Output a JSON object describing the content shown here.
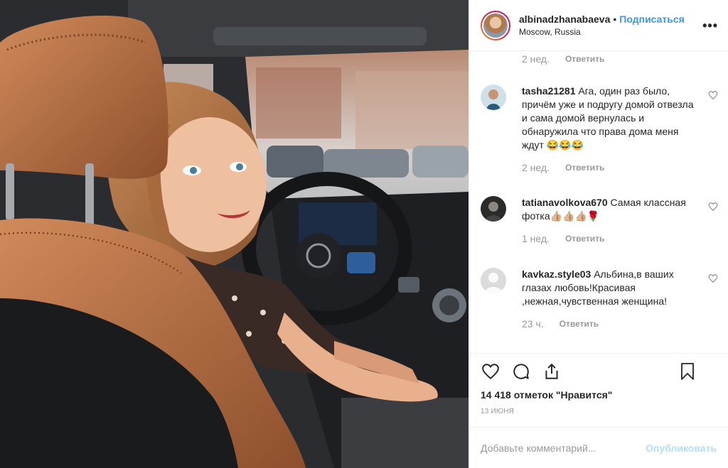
{
  "header": {
    "username": "albinadzhanabaeva",
    "separator": "•",
    "follow_label": "Подписаться",
    "location": "Moscow, Russia",
    "more_label": "•••"
  },
  "top_meta": {
    "time": "2 нед.",
    "reply_label": "Ответить"
  },
  "comments": [
    {
      "user": "tasha21281",
      "text": "Ага, один раз было, причём уже и подругу домой отвезла и сама домой вернулась и обнаружила что права дома меня ждут 😂😂😂",
      "time": "2 нед.",
      "reply_label": "Ответить"
    },
    {
      "user": "tatianavolkova670",
      "text": "Самая классная фотка👍🏼👍🏼👍🏼🌹",
      "time": "1 нед.",
      "reply_label": "Ответить"
    },
    {
      "user": "kavkaz.style03",
      "text": "Альбина,в ваших глазах любовь!Красивая ,нежная,чувственная женщина!",
      "time": "23 ч.",
      "reply_label": "Ответить"
    }
  ],
  "actions": {
    "likes": "14 418 отметок \"Нравится\"",
    "date": "13 июня"
  },
  "add_comment": {
    "placeholder": "Добавьте комментарий...",
    "post_label": "Опубликовать"
  },
  "icons": [
    "heart-icon",
    "comment-icon",
    "share-icon",
    "bookmark-icon",
    "more-icon"
  ],
  "colors": {
    "link": "#3897f0",
    "muted": "#999999",
    "post_disabled": "#b2dffc"
  }
}
